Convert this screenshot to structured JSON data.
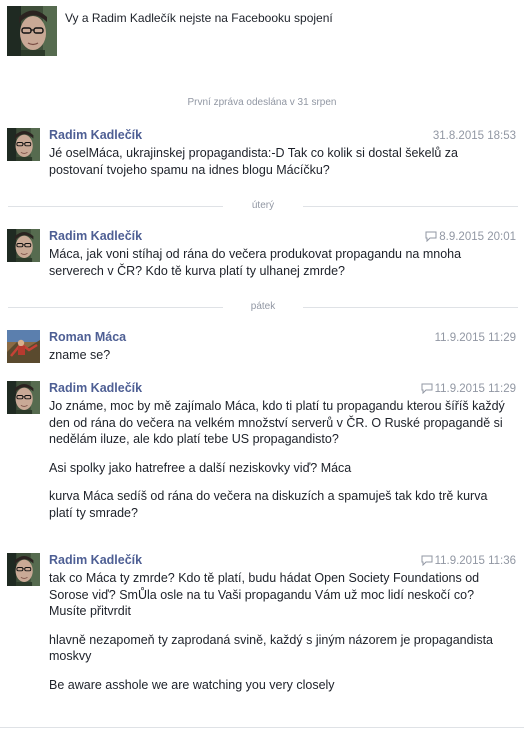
{
  "header": {
    "text": "Vy a Radim Kadlečík nejste na Facebooku spojení"
  },
  "first_message_note": "První zpráva odeslána v 31 srpen",
  "separators": [
    {
      "label": "úterý"
    },
    {
      "label": "pátek"
    }
  ],
  "messages": [
    {
      "author": "Radim Kadlečík",
      "time": "31.8.2015 18:53",
      "has_bubble_icon": false,
      "paragraphs": [
        "Jé oselMáca, ukrajinskej propagandista:-D Tak co kolik si dostal šekelů za postovaní tvojeho spamu na idnes blogu Mácíčku?"
      ]
    },
    {
      "author": "Radim Kadlečík",
      "time": "8.9.2015 20:01",
      "has_bubble_icon": true,
      "paragraphs": [
        "Máca, jak voni stíhaj od rána do večera produkovat propagandu na mnoha serverech v ČR? Kdo tě kurva platí ty ulhanej zmrde?"
      ]
    },
    {
      "author": "Roman Máca",
      "time": "11.9.2015 11:29",
      "has_bubble_icon": false,
      "paragraphs": [
        "zname se?"
      ]
    },
    {
      "author": "Radim Kadlečík",
      "time": "11.9.2015 11:29",
      "has_bubble_icon": true,
      "paragraphs": [
        "Jo známe, moc by mě zajímalo Máca, kdo ti platí tu propagandu kterou šíříš každý den od rána do večera na velkém množství serverů v ČR. O Ruské propagandě si nedělám iluze, ale kdo platí tebe US propagandisto?",
        "Asi spolky jako hatrefree a další neziskovky viď? Máca",
        "kurva Máca sedíš od rána do večera na diskuzích a spamuješ tak kdo trě kurva platí ty smrade?"
      ]
    },
    {
      "author": "Radim Kadlečík",
      "time": "11.9.2015 11:36",
      "has_bubble_icon": true,
      "paragraphs": [
        "tak co Máca ty zmrde? Kdo tě platí, budu hádat Open Society Foundations od Sorose viď? SmŮla osle na tu Vaši propagandu Vám už moc lidí neskočí co? Musíte přitvrdit",
        "hlavně nezapomeň ty zaprodaná svině, každý s jiným názorem je propagandista moskvy",
        "Be aware asshole we are watching you very closely"
      ]
    }
  ]
}
